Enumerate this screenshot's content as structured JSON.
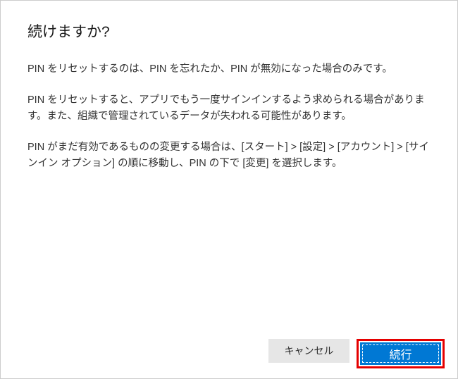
{
  "dialog": {
    "title": "続けますか?",
    "paragraphs": [
      "PIN をリセットするのは、PIN を忘れたか、PIN が無効になった場合のみです。",
      "PIN をリセットすると、アプリでもう一度サインインするよう求められる場合があります。また、組織で管理されているデータが失われる可能性があります。",
      "PIN がまだ有効であるものの変更する場合は、[スタート] > [設定] > [アカウント] > [サインイン オプション] の順に移動し、PIN の下で [変更] を選択します。"
    ],
    "buttons": {
      "cancel": "キャンセル",
      "continue": "続行"
    }
  }
}
